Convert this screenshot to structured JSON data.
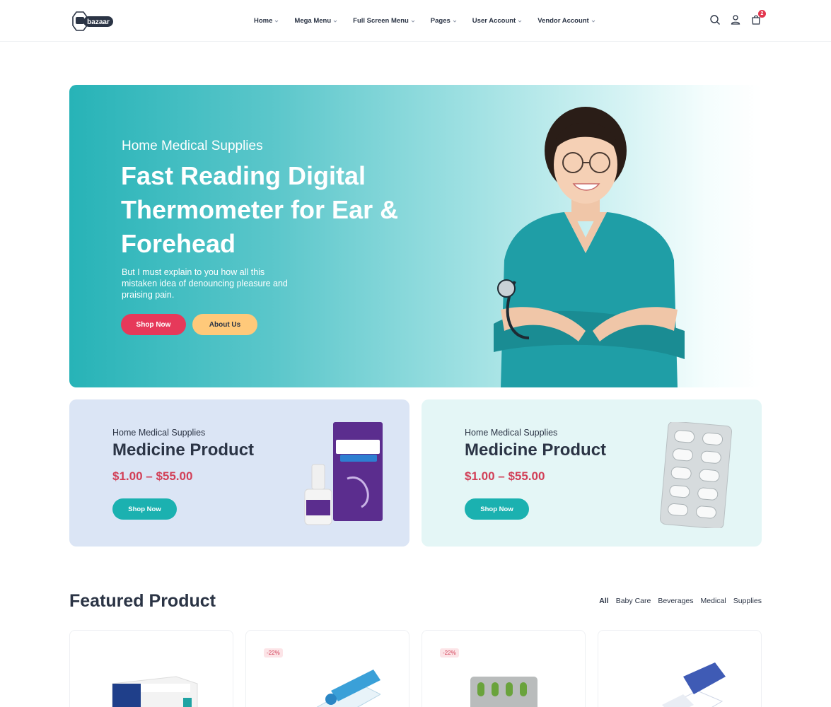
{
  "header": {
    "logo_text": "bazaar",
    "nav": [
      {
        "label": "Home"
      },
      {
        "label": "Mega Menu"
      },
      {
        "label": "Full Screen Menu"
      },
      {
        "label": "Pages"
      },
      {
        "label": "User Account"
      },
      {
        "label": "Vendor Account"
      }
    ],
    "icons": [
      "search-icon",
      "user-icon",
      "cart-icon"
    ],
    "cart_count": "2"
  },
  "hero": {
    "subtitle": "Home Medical Supplies",
    "title": "Fast Reading Digital Thermometer for Ear & Forehead",
    "description": "But I must explain to you how all this mistaken idea of denouncing pleasure and praising pain.",
    "primary_button": "Shop Now",
    "secondary_button": "About Us"
  },
  "promos": [
    {
      "subtitle": "Home Medical Supplies",
      "title": "Medicine Product",
      "price": "$1.00 – $55.00",
      "button": "Shop Now"
    },
    {
      "subtitle": "Home Medical Supplies",
      "title": "Medicine Product",
      "price": "$1.00 – $55.00",
      "button": "Shop Now"
    }
  ],
  "featured": {
    "title": "Featured Product",
    "filters": [
      "All",
      "Baby Care",
      "Beverages",
      "Medical",
      "Supplies"
    ],
    "active_filter": "All",
    "products": [
      {
        "discount": ""
      },
      {
        "discount": "-22%"
      },
      {
        "discount": "-22%"
      },
      {
        "discount": ""
      }
    ]
  },
  "colors": {
    "accent_red": "#e6395a",
    "accent_teal": "#1bb1b0",
    "price_red": "#d23f57",
    "text_dark": "#2b3445",
    "about_button": "#ffc97a"
  }
}
